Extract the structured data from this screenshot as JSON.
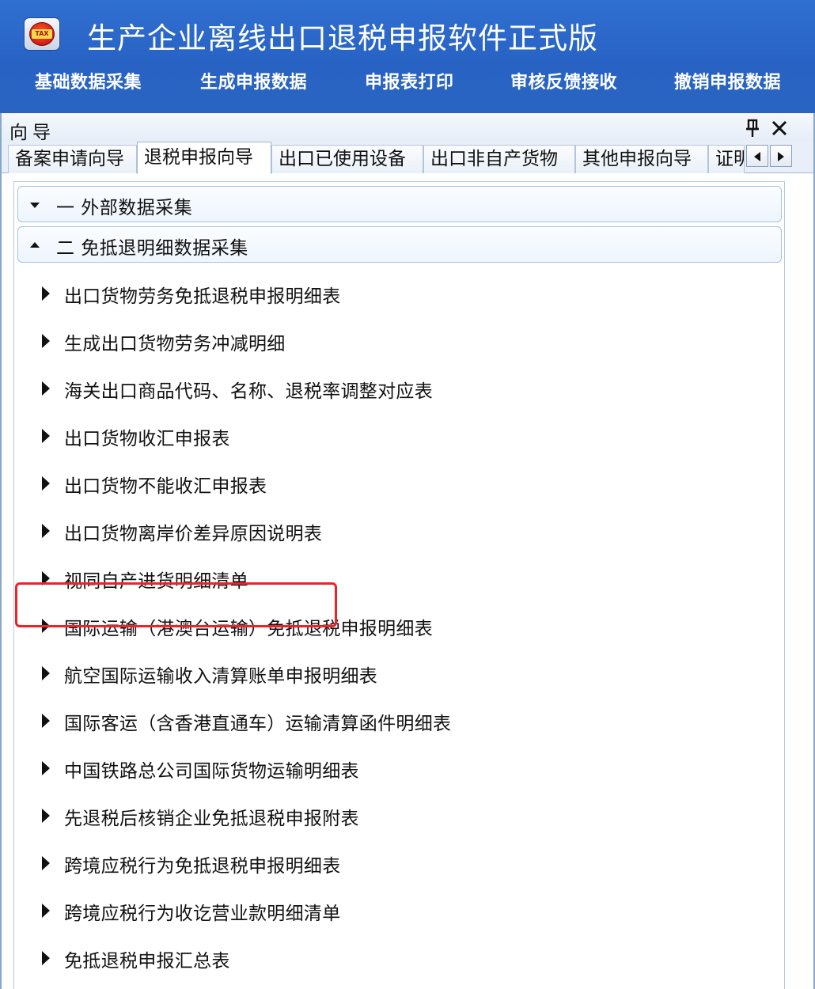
{
  "app": {
    "title": "生产企业离线出口退税申报软件正式版",
    "logo_text": "TAX",
    "menu": [
      "基础数据采集",
      "生成申报数据",
      "申报表打印",
      "审核反馈接收",
      "撤销申报数据"
    ]
  },
  "guide": {
    "title": "向导",
    "tabs": [
      "备案申请向导",
      "退税申报向导",
      "出口已使用设备",
      "出口非自产货物",
      "其他申报向导",
      "证明"
    ],
    "active_tab": "退税申报向导",
    "sections": [
      {
        "label": "一  外部数据采集",
        "expanded": false
      },
      {
        "label": "二  免抵退明细数据采集",
        "expanded": true
      }
    ],
    "items": [
      "出口货物劳务免抵退税申报明细表",
      "生成出口货物劳务冲减明细",
      "海关出口商品代码、名称、退税率调整对应表",
      "出口货物收汇申报表",
      "出口货物不能收汇申报表",
      "出口货物离岸价差异原因说明表",
      "视同自产进货明细清单",
      "国际运输（港澳台运输）免抵退税申报明细表",
      "航空国际运输收入清算账单申报明细表",
      "国际客运（含香港直通车）运输清算函件明细表",
      "中国铁路总公司国际货物运输明细表",
      "先退税后核销企业免抵退税申报附表",
      "跨境应税行为免抵退税申报明细表",
      "跨境应税行为收讫营业款明细清单",
      "免抵退税申报汇总表"
    ],
    "highlighted_item": "出口货物不能收汇申报表"
  },
  "colors": {
    "title_bar": "#2a64c2",
    "highlight_border": "#e8262a",
    "section_border": "#a6c3e6"
  },
  "icons": [
    "app-logo-icon",
    "pin-icon",
    "close-icon",
    "tab-scroll-left-icon",
    "tab-scroll-right-icon",
    "collapse-caret-icon",
    "expand-caret-icon",
    "item-arrow-icon"
  ]
}
